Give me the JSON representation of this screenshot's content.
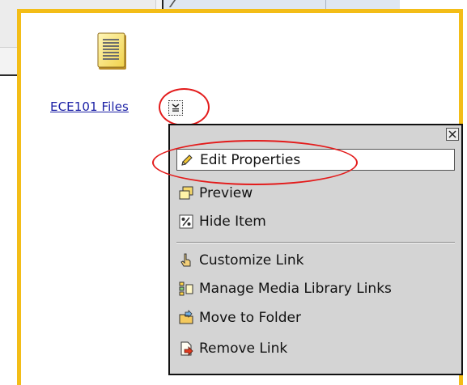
{
  "content_item": {
    "link_text": "ECE101 Files",
    "icon": "text-document-icon"
  },
  "context_menu": {
    "close_icon": "close-icon",
    "items": [
      {
        "label": "Edit Properties",
        "icon": "pencil-icon",
        "selected": true
      },
      {
        "label": "Preview",
        "icon": "preview-window-icon"
      },
      {
        "label": "Hide Item",
        "icon": "hide-item-icon"
      },
      {
        "label": "Customize Link",
        "icon": "hand-pointer-icon"
      },
      {
        "label": "Manage Media Library Links",
        "icon": "media-library-icon"
      },
      {
        "label": "Move to Folder",
        "icon": "folder-move-icon"
      },
      {
        "label": "Remove Link",
        "icon": "remove-link-icon"
      }
    ]
  },
  "colors": {
    "highlight_border": "#f3bd17",
    "annotation_circle": "#e31b1b",
    "link": "#1c21a6",
    "menu_bg": "#d4d4d4"
  }
}
